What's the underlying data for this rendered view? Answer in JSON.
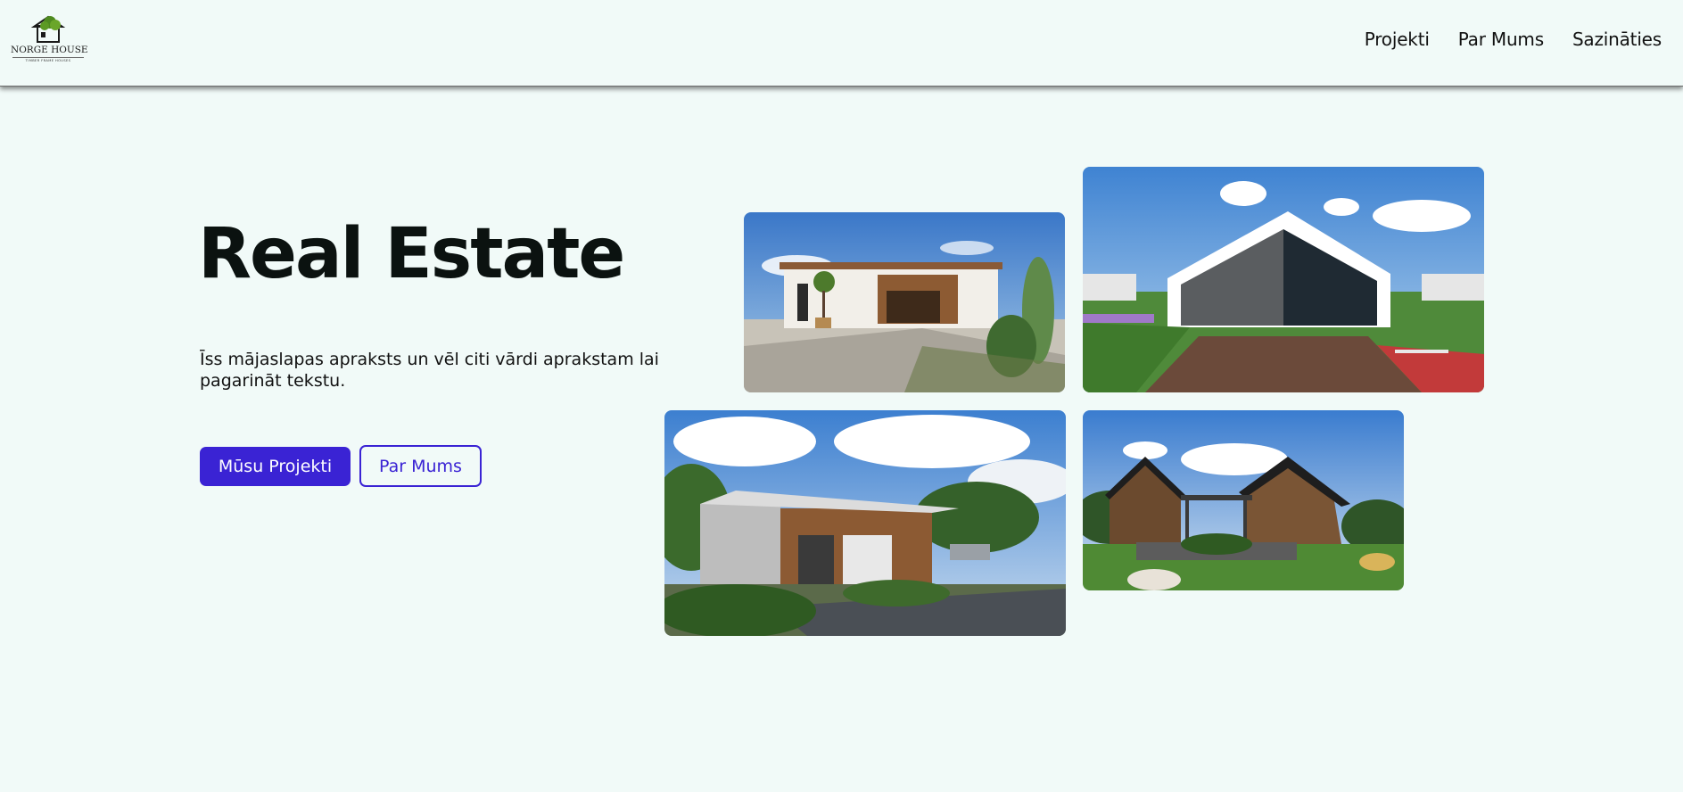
{
  "header": {
    "logo": {
      "name": "NORGE HOUSE",
      "tagline": "TIMBER FRAME HOUSES"
    },
    "nav": [
      {
        "label": "Projekti"
      },
      {
        "label": "Par Mums"
      },
      {
        "label": "Sazināties"
      }
    ]
  },
  "hero": {
    "title": "Real Estate",
    "description": "Īss mājaslapas apraksts un vēl citi vārdi aprakstam lai pagarināt tekstu.",
    "primary_button": "Mūsu Projekti",
    "secondary_button": "Par Mums"
  },
  "gallery": [
    {
      "subject": "modern-white-house-with-cactus"
    },
    {
      "subject": "white-gabled-house-with-garden"
    },
    {
      "subject": "flat-roof-house-with-wood-cladding"
    },
    {
      "subject": "dark-timber-barn-houses"
    }
  ],
  "colors": {
    "background": "#f1faf8",
    "accent": "#3a23d4",
    "text": "#0b1210"
  }
}
